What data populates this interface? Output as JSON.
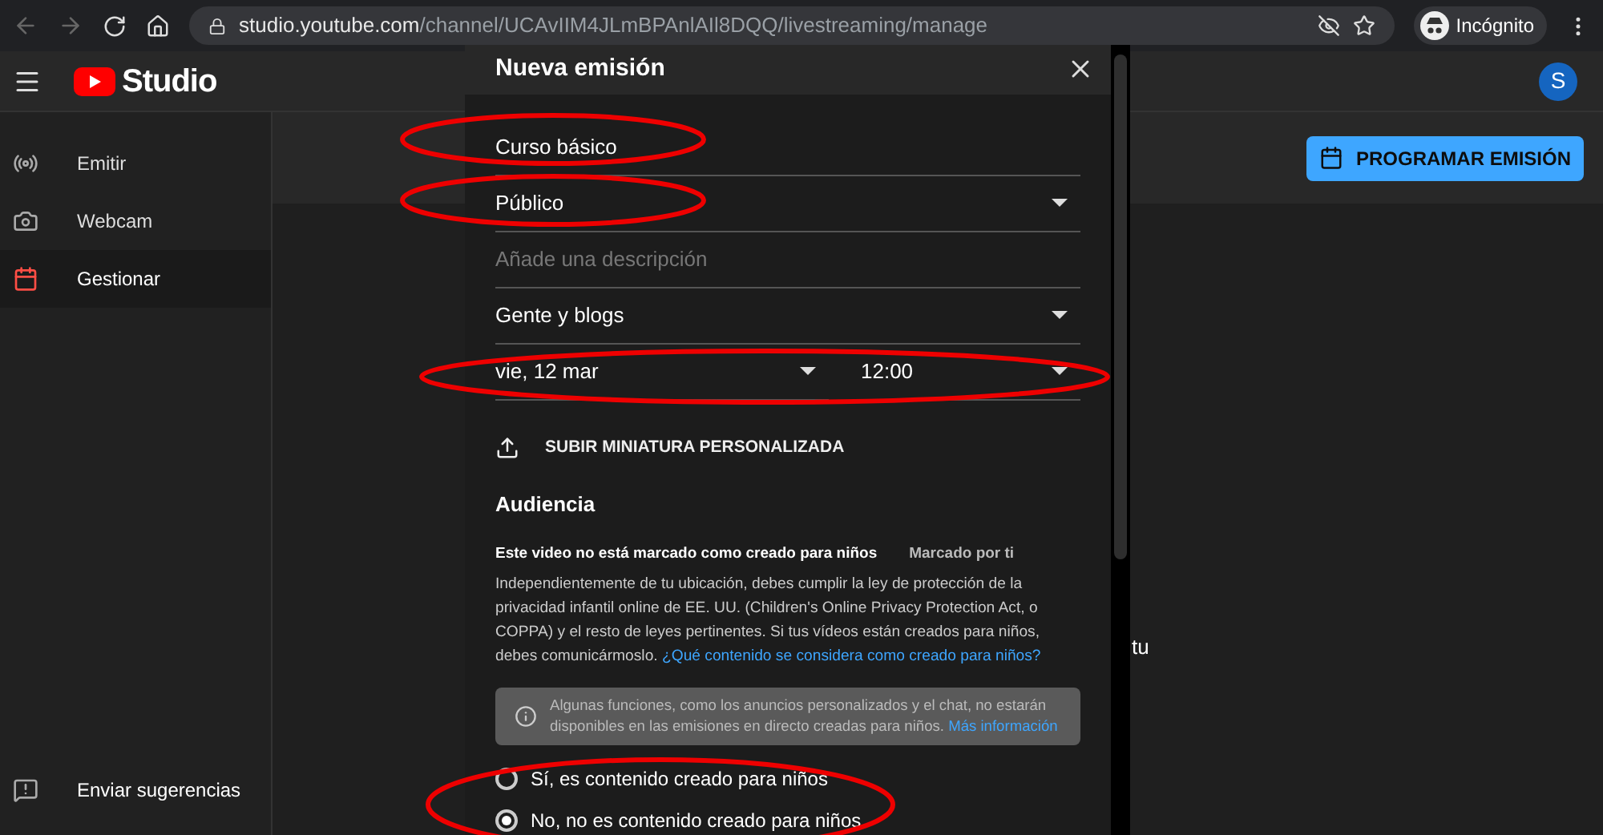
{
  "browser": {
    "url_host": "studio.youtube.com",
    "url_path": "/channel/UCAvIIM4JLmBPAnlAIl8DQQ/livestreaming/manage",
    "profile": "Incógnito"
  },
  "header": {
    "logo": "Studio",
    "avatar": "S"
  },
  "sidebar": {
    "items": [
      {
        "label": "Emitir",
        "kind": "broadcast",
        "selected": false
      },
      {
        "label": "Webcam",
        "kind": "camera",
        "selected": false
      },
      {
        "label": "Gestionar",
        "kind": "calendar",
        "selected": true
      }
    ],
    "feedback": "Enviar sugerencias"
  },
  "main": {
    "button": "PROGRAMAR EMISIÓN",
    "background_text": "tu"
  },
  "dialog": {
    "title": "Nueva emisión",
    "fields": [
      {
        "kind": "text",
        "value": "Curso básico"
      },
      {
        "kind": "select",
        "value": "Público"
      },
      {
        "kind": "text",
        "placeholder": "Añade una descripción"
      },
      {
        "kind": "select",
        "value": "Gente y blogs"
      }
    ],
    "date": "vie, 12 mar",
    "time": "12:00",
    "upload": "SUBIR MINIATURA PERSONALIZADA",
    "audience": {
      "heading": "Audiencia",
      "status": "Este video no está marcado como creado para niños",
      "marked_by": "Marcado por ti",
      "paragraph": "Independientemente de tu ubicación, debes cumplir la ley de protección de la privacidad infantil online de EE. UU. (Children's Online Privacy Protection Act, o COPPA) y el resto de leyes pertinentes. Si tus vídeos están creados para niños, debes comunicármoslo.",
      "link": "¿Qué contenido se considera como creado para niños?",
      "notice": "Algunas funciones, como los anuncios personalizados y el chat, no estarán disponibles en las emisiones en directo creadas para niños.",
      "notice_link": "Más información",
      "options": [
        {
          "label": "Sí, es contenido creado para niños",
          "selected": false
        },
        {
          "label": "No, no es contenido creado para niños",
          "selected": true
        }
      ]
    }
  }
}
